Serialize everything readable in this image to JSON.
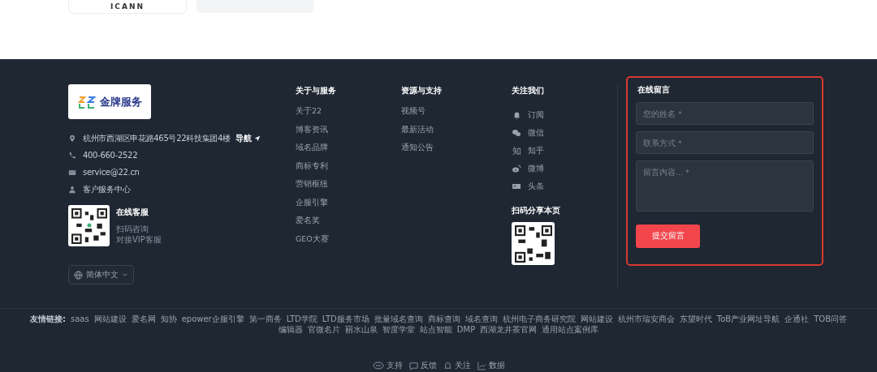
{
  "top_cards": [
    {
      "kind": "logo",
      "label": "ICANN"
    },
    {
      "kind": "photo"
    }
  ],
  "brand": {
    "logo_text": "金牌服务"
  },
  "contacts": [
    {
      "text": "杭州市西湖区申花路465号22科技集团4楼",
      "link": "导航"
    },
    {
      "text": "400-660-2522"
    },
    {
      "text": "service@22.cn"
    },
    {
      "text": "客户服务中心"
    }
  ],
  "service": {
    "title": "在线客服",
    "lines": [
      "扫码咨询",
      "对接VIP客服"
    ]
  },
  "language": "简体中文",
  "columns": [
    {
      "title": "关于与服务",
      "items": [
        {
          "label": "关于22"
        },
        {
          "label": "博客资讯"
        },
        {
          "label": "域名品牌"
        },
        {
          "label": "商标专利"
        },
        {
          "label": "营销枢纽"
        },
        {
          "label": "企服引擎"
        },
        {
          "label": "爱名奖"
        },
        {
          "label": "GEO大赛"
        }
      ]
    },
    {
      "title": "资源与支持",
      "items": [
        {
          "label": "视频号"
        },
        {
          "label": "最新活动"
        },
        {
          "label": "通知公告"
        }
      ]
    },
    {
      "title": "关注我们",
      "kind": "social",
      "items": [
        {
          "label": "订阅"
        },
        {
          "label": "微信"
        },
        {
          "glyph": "知",
          "label": "知乎"
        },
        {
          "label": "微博"
        },
        {
          "label": "头条"
        }
      ],
      "share_title": "扫码分享本页"
    }
  ],
  "form": {
    "title": "在线留言",
    "fields": [
      {
        "kind": "input",
        "placeholder": "您的姓名 *"
      },
      {
        "kind": "input",
        "placeholder": "联系方式 *"
      },
      {
        "kind": "textarea",
        "placeholder": "留言内容... *"
      }
    ],
    "button": "提交留言"
  },
  "friend_links": {
    "label": "友情链接:",
    "links": [
      "saas",
      "网站建设",
      "爱名网",
      "知协",
      "epower企服引擎",
      "第一商务",
      "LTD学院",
      "LTD服务市场",
      "批量域名查询",
      "商标查询",
      "域名查询",
      "杭州电子商务研究院",
      "网站建设",
      "杭州市瑞安商会",
      "东望时代",
      "ToB产业网址导航",
      "企通社",
      "TOB问答",
      "编辑器",
      "官微名片",
      "丽水山泉",
      "智度学堂",
      "站点智能",
      "DMP",
      "西湖龙井茶官网",
      "通用站点案例库"
    ]
  },
  "bottom_bar": [
    {
      "label": "支持"
    },
    {
      "label": "反馈"
    },
    {
      "label": "关注"
    },
    {
      "label": "数据"
    }
  ]
}
